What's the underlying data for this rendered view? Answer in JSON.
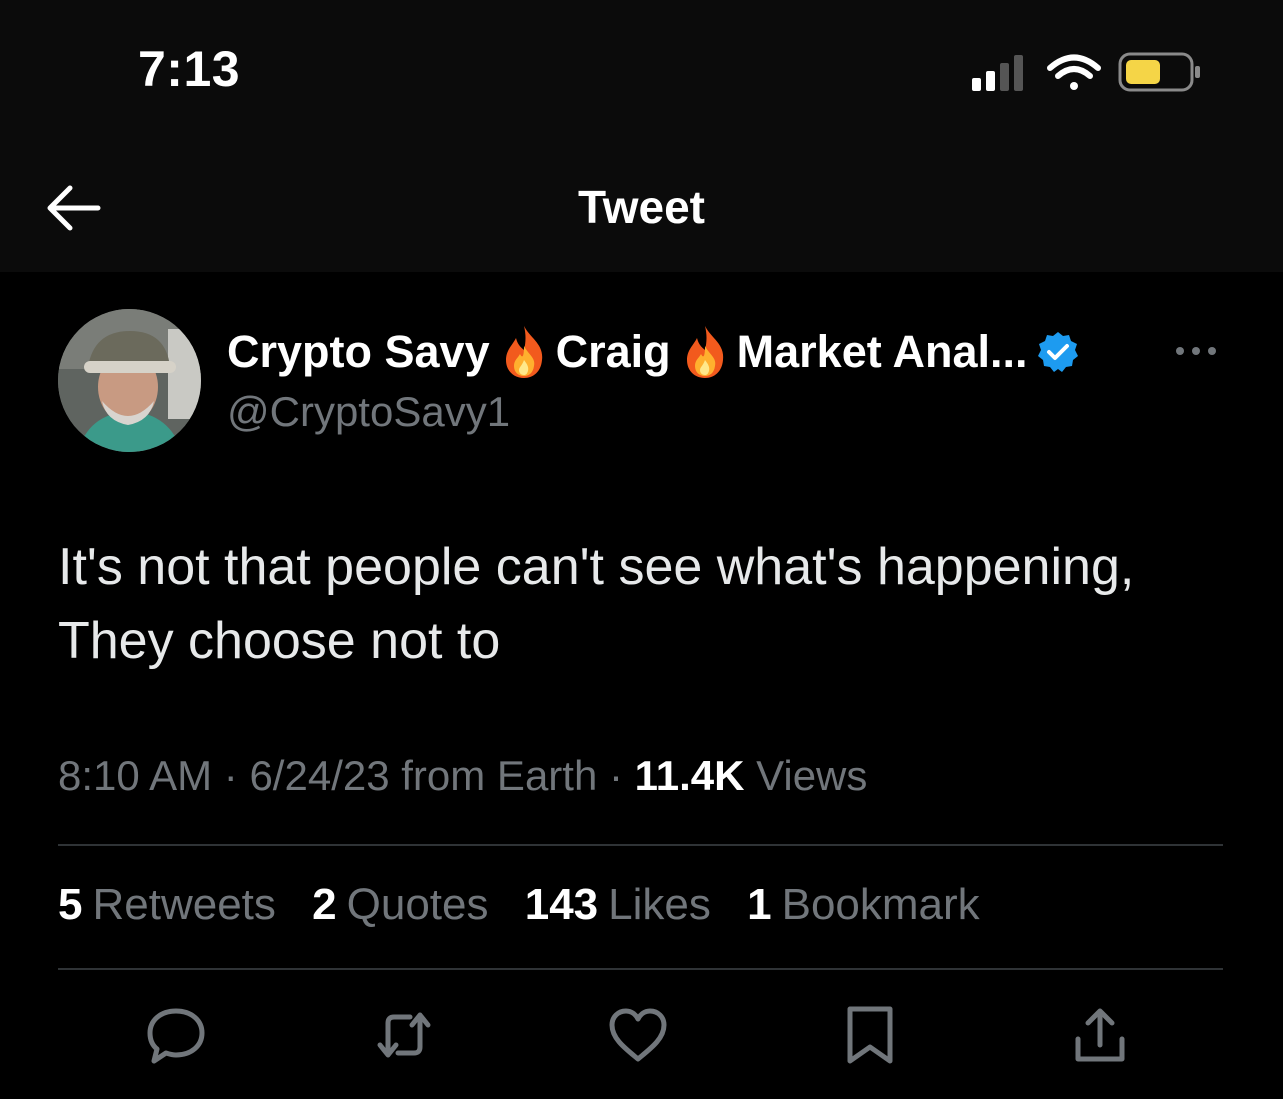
{
  "status_bar": {
    "time": "7:13",
    "icons": [
      "cellular-signal-icon",
      "wifi-icon",
      "battery-icon"
    ],
    "battery_color": "#f5d547"
  },
  "header": {
    "title": "Tweet",
    "back_icon": "back-arrow-icon"
  },
  "tweet": {
    "author": {
      "name_parts": [
        "Crypto Savy",
        "Craig",
        "Market Anal..."
      ],
      "name_emoji": "fire-emoji",
      "handle": "@CryptoSavy1",
      "verified": true,
      "verified_color": "#1d9bf0"
    },
    "text_lines": [
      "It's not that people can't see what's happening,",
      "They choose not to"
    ],
    "meta": {
      "time": "8:10 AM",
      "separator": "·",
      "date": "6/24/23",
      "source": "from Earth",
      "views_count": "11.4K",
      "views_label": "Views"
    },
    "stats": [
      {
        "count": "5",
        "label": "Retweets"
      },
      {
        "count": "2",
        "label": "Quotes"
      },
      {
        "count": "143",
        "label": "Likes"
      },
      {
        "count": "1",
        "label": "Bookmark"
      }
    ],
    "actions": [
      "reply-icon",
      "retweet-icon",
      "like-icon",
      "bookmark-icon",
      "share-icon"
    ]
  },
  "colors": {
    "background": "#000000",
    "header_background": "#0b0b0b",
    "text_primary": "#e7e9ea",
    "text_secondary": "#71767b",
    "divider": "#2f3336"
  }
}
